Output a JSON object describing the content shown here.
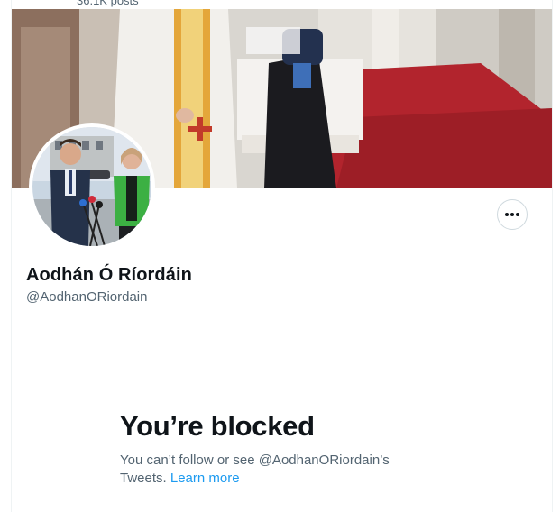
{
  "header": {
    "posts_count": "36.1K posts"
  },
  "profile": {
    "display_name": "Aodhán Ó Ríordáin",
    "handle": "@AodhanORiordain",
    "more_icon": "ellipsis-icon"
  },
  "blocked": {
    "title": "You’re blocked",
    "message": "You can’t follow or see @AodhanORiordain’s Tweets.",
    "learn_more": "Learn more"
  },
  "colors": {
    "accent": "#1d9bf0",
    "secondary_text": "#536471",
    "border": "#eff3f4"
  }
}
